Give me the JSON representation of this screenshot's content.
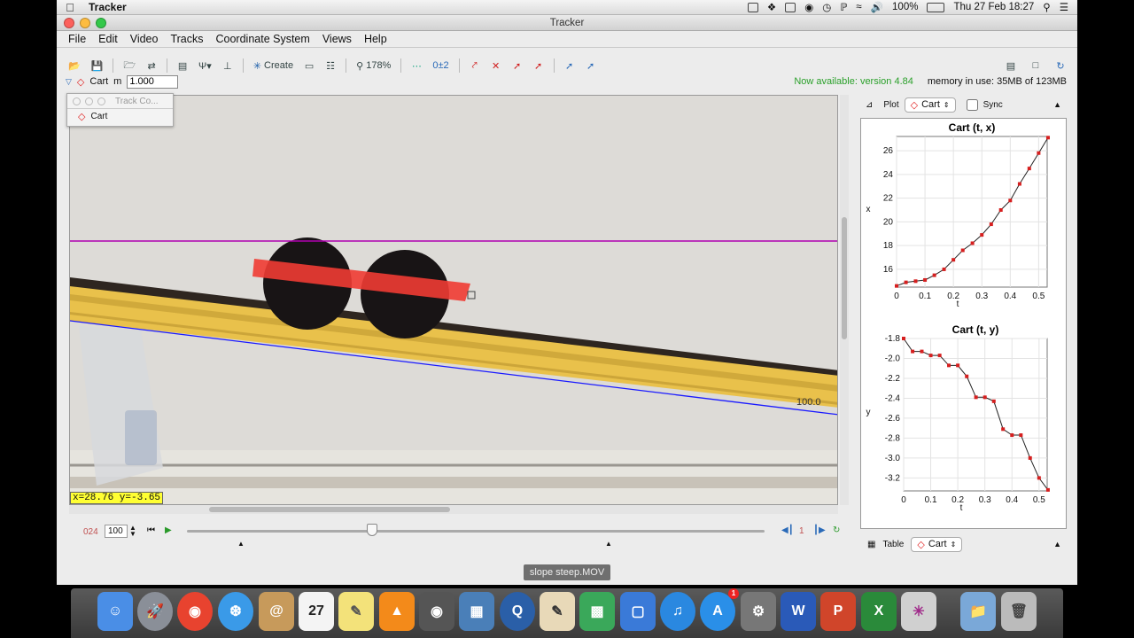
{
  "system_menubar": {
    "app_name": "Tracker",
    "battery": "100%",
    "datetime": "Thu 27 Feb  18:27"
  },
  "window": {
    "title": "Tracker",
    "menu": [
      "File",
      "Edit",
      "Video",
      "Tracks",
      "Coordinate System",
      "Views",
      "Help"
    ]
  },
  "toolbar": {
    "create_label": "Create",
    "zoom": "178%",
    "autostep_label": "0±2"
  },
  "trackbar": {
    "track_name": "Cart",
    "mass_label": "m",
    "mass_value": "1.000",
    "update_notice": "Now available: version 4.84",
    "memory": "memory in use: 35MB of 123MB"
  },
  "video": {
    "coord_readout": "x=28.76  y=-3.65",
    "scale_label": "100.0"
  },
  "track_control": {
    "title": "Track Co...",
    "item": "Cart"
  },
  "player": {
    "frame": "024",
    "rate": "100",
    "step": "1",
    "position": 0.32
  },
  "plot_panel": {
    "label": "Plot",
    "track": "Cart",
    "sync_label": "Sync"
  },
  "table_panel": {
    "label": "Table",
    "track": "Cart"
  },
  "filename": "slope steep.MOV",
  "chart_data": [
    {
      "type": "line",
      "title": "Cart (t, x)",
      "xlabel": "t",
      "ylabel": "x",
      "xlim": [
        0,
        0.53
      ],
      "ylim": [
        14.5,
        27.2
      ],
      "xticks": [
        "0",
        "0.1",
        "0.2",
        "0.3",
        "0.4",
        "0.5"
      ],
      "yticks": [
        "16",
        "18",
        "20",
        "22",
        "24",
        "26"
      ],
      "x": [
        0,
        0.033,
        0.067,
        0.1,
        0.133,
        0.167,
        0.2,
        0.233,
        0.267,
        0.3,
        0.333,
        0.367,
        0.4,
        0.433,
        0.467,
        0.5,
        0.533
      ],
      "y": [
        14.6,
        14.9,
        15.0,
        15.1,
        15.5,
        16.0,
        16.8,
        17.6,
        18.2,
        18.9,
        19.8,
        21.0,
        21.8,
        23.2,
        24.5,
        25.8,
        27.1
      ]
    },
    {
      "type": "line",
      "title": "Cart (t, y)",
      "xlabel": "t",
      "ylabel": "y",
      "xlim": [
        0,
        0.53
      ],
      "ylim": [
        -3.33,
        -1.8
      ],
      "xticks": [
        "0",
        "0.1",
        "0.2",
        "0.3",
        "0.4",
        "0.5"
      ],
      "yticks": [
        "-1.8",
        "-2.0",
        "-2.2",
        "-2.4",
        "-2.6",
        "-2.8",
        "-3.0",
        "-3.2"
      ],
      "x": [
        0,
        0.033,
        0.067,
        0.1,
        0.133,
        0.167,
        0.2,
        0.233,
        0.267,
        0.3,
        0.333,
        0.367,
        0.4,
        0.433,
        0.467,
        0.5,
        0.533
      ],
      "y": [
        -1.8,
        -1.93,
        -1.93,
        -1.97,
        -1.97,
        -2.07,
        -2.07,
        -2.18,
        -2.39,
        -2.39,
        -2.43,
        -2.71,
        -2.77,
        -2.77,
        -3.0,
        -3.2,
        -3.32
      ]
    }
  ],
  "colors": {
    "track": "#d61f1f",
    "axis_line": "#b000b0",
    "tape_line": "#1a1aff",
    "readout_bg": "#ffff33",
    "update_notice": "#2aa02a"
  }
}
